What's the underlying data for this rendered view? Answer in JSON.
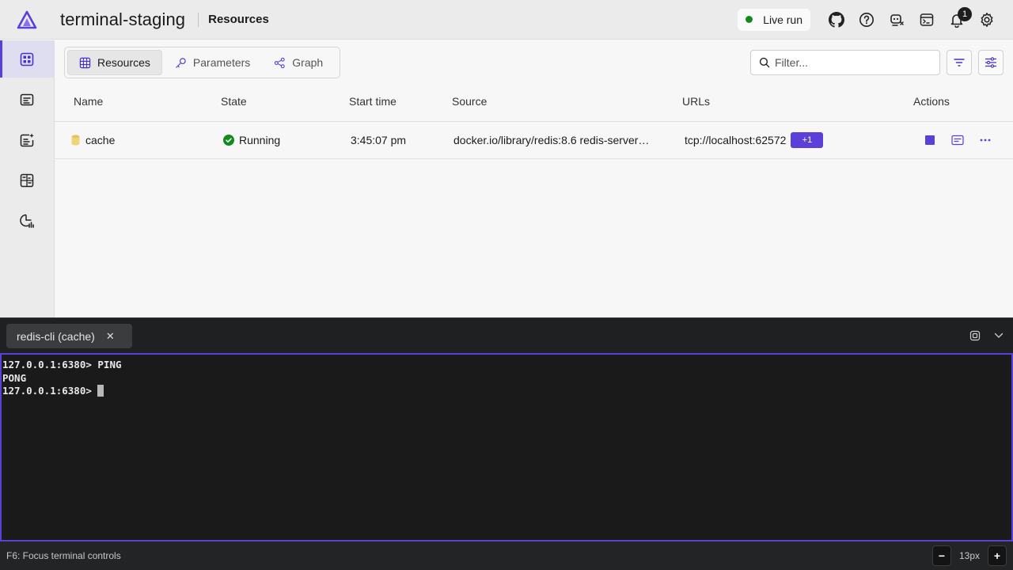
{
  "header": {
    "app_title": "terminal-staging",
    "page_crumb": "Resources",
    "live_run_label": "Live run",
    "notification_count": "1",
    "icons": [
      "github-icon",
      "help-icon",
      "copilot-icon",
      "console-icon",
      "bell-icon",
      "gear-icon"
    ]
  },
  "sidebar": {
    "items": [
      {
        "name": "resources",
        "icon": "grid-icon",
        "active": true
      },
      {
        "name": "console-logs",
        "icon": "log-icon"
      },
      {
        "name": "structured-logs",
        "icon": "sparkle-log-icon"
      },
      {
        "name": "traces",
        "icon": "traces-icon"
      },
      {
        "name": "metrics",
        "icon": "metrics-icon"
      }
    ]
  },
  "tabs": [
    {
      "label": "Resources",
      "icon": "table-icon",
      "active": true
    },
    {
      "label": "Parameters",
      "icon": "key-icon"
    },
    {
      "label": "Graph",
      "icon": "share-graph-icon"
    }
  ],
  "filter": {
    "placeholder": "Filter..."
  },
  "grid": {
    "columns": [
      "Name",
      "State",
      "Start time",
      "Source",
      "URLs",
      "Actions"
    ],
    "rows": [
      {
        "name": "cache",
        "state": "Running",
        "start_time": "3:45:07 pm",
        "source": "docker.io/library/redis:8.6 redis-server…",
        "url": "tcp://localhost:62572",
        "more_urls": "+1"
      }
    ]
  },
  "terminal": {
    "tab_label": "redis-cli (cache)",
    "lines": [
      "127.0.0.1:6380> PING",
      "PONG",
      "127.0.0.1:6380> "
    ]
  },
  "statusbar": {
    "hint": "F6: Focus terminal controls",
    "font_size": "13px",
    "decrease_label": "−",
    "increase_label": "+"
  },
  "colors": {
    "accent": "#5b3fd9",
    "running": "#138a1d",
    "terminal_bg": "#1a1a1a"
  }
}
